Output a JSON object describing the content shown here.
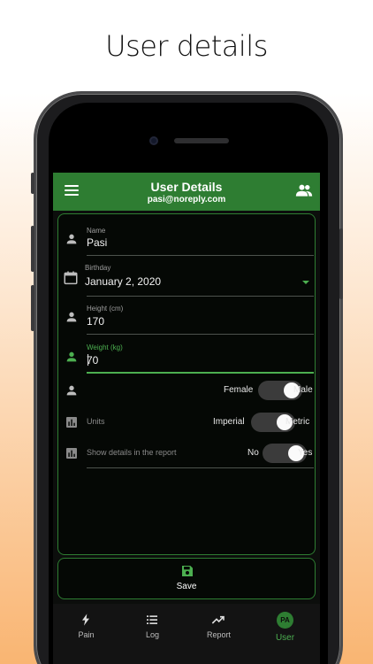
{
  "headline": "User details",
  "appbar": {
    "title": "User Details",
    "subtitle": "pasi@noreply.com"
  },
  "form": {
    "name": {
      "label": "Name",
      "value": "Pasi"
    },
    "birthday": {
      "label": "Birthday",
      "value": "January 2, 2020"
    },
    "height": {
      "label": "Height (cm)",
      "value": "170"
    },
    "weight": {
      "label": "Weight (kg)",
      "value": "70"
    },
    "gender": {
      "left": "Female",
      "right": "Male"
    },
    "units": {
      "label": "Units",
      "left": "Imperial",
      "right": "Metric"
    },
    "report": {
      "label": "Show details in the report",
      "left": "No",
      "right": "Yes"
    }
  },
  "save": {
    "label": "Save"
  },
  "nav": [
    {
      "label": "Pain",
      "icon": "bolt-icon"
    },
    {
      "label": "Log",
      "icon": "list-icon"
    },
    {
      "label": "Report",
      "icon": "trending-up-icon"
    },
    {
      "label": "User",
      "icon": "avatar",
      "avatar_text": "PA"
    }
  ],
  "colors": {
    "accent": "#2e7d32",
    "accent_light": "#4caf50",
    "background": "#0c0e0c"
  }
}
